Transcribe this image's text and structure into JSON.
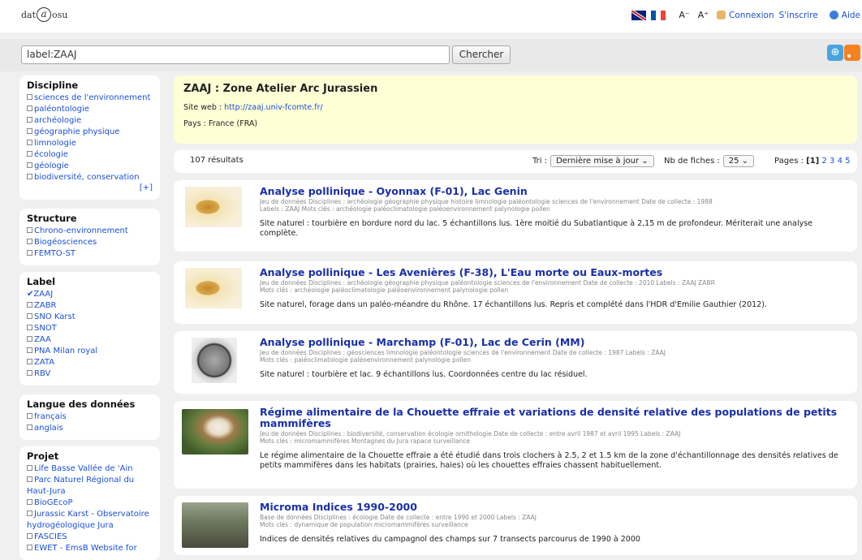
{
  "header": {
    "logo_left": "dat",
    "logo_circle": "a",
    "logo_right": "osu",
    "font_small": "A⁻",
    "font_large": "A⁺",
    "login": "Connexion",
    "signup": "S'inscrire",
    "help": "Aide"
  },
  "search": {
    "value": "label:ZAAJ",
    "button": "Chercher"
  },
  "facets": {
    "discipline": {
      "title": "Discipline",
      "items": [
        "sciences de l'environnement",
        "paléontologie",
        "archéologie",
        "géographie physique",
        "limnologie",
        "écologie",
        "géologie",
        "biodiversité, conservation"
      ],
      "more": "[+]"
    },
    "structure": {
      "title": "Structure",
      "items": [
        "Chrono-environnement",
        "Biogéosciences",
        "FEMTO-ST"
      ]
    },
    "label": {
      "title": "Label",
      "items": [
        "ZAAJ",
        "ZABR",
        "SNO Karst",
        "SNOT",
        "ZAA",
        "PNA Milan royal",
        "ZATA",
        "RBV"
      ]
    },
    "langue": {
      "title": "Langue des données",
      "items": [
        "français",
        "anglais"
      ]
    },
    "projet": {
      "title": "Projet",
      "items": [
        "Life Basse Vallée de 'Ain",
        "Parc Naturel Régional du Haut-Jura",
        "BioGEcoP",
        "Jurassic Karst - Observatoire hydrogéologique Jura",
        "FASCIES",
        "EWET - EmsB Website for"
      ]
    }
  },
  "zone": {
    "title": "ZAAJ : Zone Atelier Arc Jurassien",
    "site_label": "Site web : ",
    "site_url": "http://zaaj.univ-fcomte.fr/",
    "pays": "Pays : France (FRA)"
  },
  "results_bar": {
    "count": "107 résultats",
    "tri_label": "Tri :",
    "tri_value": "Dernière mise à jour",
    "fiches_label": "Nb de fiches :",
    "fiches_value": "25",
    "pages_label": "Pages :",
    "current_page": "[1]",
    "pages": [
      "2",
      "3",
      "4",
      "5"
    ]
  },
  "results": [
    {
      "title": "Analyse pollinique - Oyonnax (F-01), Lac Genin",
      "meta1": "Jeu de données   Disciplines : archéologie géographie physique histoire limnologie paléontologie sciences de l'environnement   Date de collecte : 1988",
      "meta2": "Labels : ZAAJ   Mots clés : archéologie paléoclimatologie paléoenvironnement palynologie pollen",
      "desc": "Site naturel : tourbière en bordure nord du lac. 5 échantillons lus. 1ère moitié du Subatlantique à 2,15 m de profondeur. Mériterait une analyse complète."
    },
    {
      "title": "Analyse pollinique - Les Avenières (F-38), L'Eau morte ou Eaux-mortes",
      "meta1": "Jeu de données   Disciplines : archéologie géographie physique paléontologie sciences de l'environnement   Date de collecte : 2010   Labels : ZAAJ ZABR",
      "meta2": "Mots clés : archéologie paléoclimatologie paléoenvironnement palynologie pollen",
      "desc": "Site naturel, forage dans un paléo-méandre du Rhône. 17 échantillons lus. Repris et complété dans l'HDR d'Emilie Gauthier (2012)."
    },
    {
      "title": "Analyse pollinique - Marchamp (F-01), Lac de Cerin (MM)",
      "meta1": "Jeu de données   Disciplines : géosciences limnologie paléontologie sciences de l'environnement   Date de collecte : 1987   Labels : ZAAJ",
      "meta2": "Mots clés : paléoclimatologie paléoenvironnement palynologie pollen",
      "desc": "Site naturel : tourbière et lac. 9 échantillons lus. Coordonnées centre du lac résiduel."
    },
    {
      "title": "Régime alimentaire de la Chouette effraie et variations de densité relative des populations de petits mammifères",
      "meta1": "Jeu de données   Disciplines : biodiversité, conservation écologie ornithologie   Date de collecte : entre avril 1987 et avril 1995   Labels : ZAAJ",
      "meta2": "Mots clés : micromammifères Montagnes du Jura rapace surveillance",
      "desc": "Le régime alimentaire de la Chouette effraie a été étudié dans trois clochers à 2.5, 2 et 1.5 km de la zone d'échantillonnage des densités relatives de petits mammifères dans les habitats (prairies, haies) où les chouettes effraies chassent habituellement."
    },
    {
      "title": "Microma Indices 1990-2000",
      "meta1": "Base de données   Disciplines : écologie   Date de collecte : entre 1990 et 2000   Labels : ZAAJ",
      "meta2": "Mots clés : dynamique de population micromammifères surveillance",
      "desc": "Indices de densités relatives du campagnol des champs sur 7 transects parcourus de 1990 à 2000"
    }
  ]
}
